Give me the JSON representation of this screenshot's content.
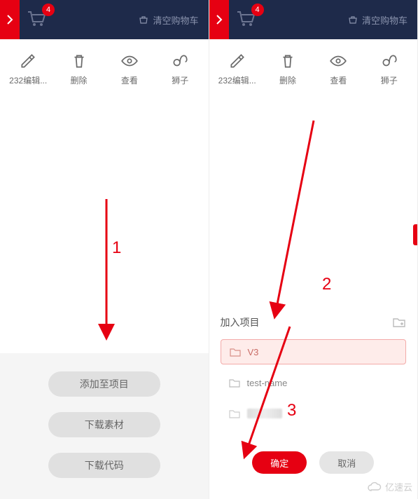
{
  "cart_badge": "4",
  "clear_cart_label": "清空购物车",
  "toolbar": [
    {
      "label": "232编辑...",
      "icon": "edit"
    },
    {
      "label": "删除",
      "icon": "delete"
    },
    {
      "label": "查看",
      "icon": "view"
    },
    {
      "label": "狮子",
      "icon": "leo"
    }
  ],
  "actions": {
    "add_to_project": "添加至项目",
    "download_assets": "下载素材",
    "download_code": "下载代码"
  },
  "modal": {
    "title": "加入项目",
    "projects": [
      {
        "name": "V3",
        "selected": true
      },
      {
        "name": "test-name",
        "selected": false
      }
    ],
    "confirm": "确定",
    "cancel": "取消"
  },
  "annotations": {
    "n1": "1",
    "n2": "2",
    "n3": "3"
  },
  "watermark": "亿速云"
}
